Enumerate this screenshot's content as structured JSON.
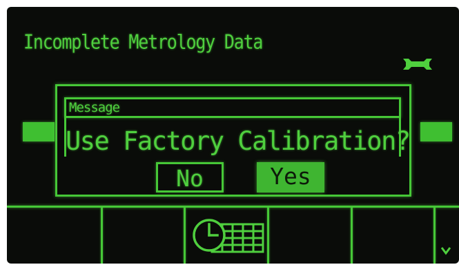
{
  "screen": {
    "title": "Incomplete Metrology Data",
    "status_icon": "wrench-icon"
  },
  "dialog": {
    "header": "Message",
    "question": "Use Factory Calibration?",
    "buttons": {
      "no_label": "No",
      "yes_label": "Yes",
      "selected": "Yes"
    }
  },
  "softkeys": [
    {
      "id": "softkey-1",
      "icon": ""
    },
    {
      "id": "softkey-2",
      "icon": ""
    },
    {
      "id": "softkey-3",
      "icon": "clock-calendar-icon"
    },
    {
      "id": "softkey-4",
      "icon": ""
    },
    {
      "id": "softkey-5",
      "icon": ""
    },
    {
      "id": "softkey-more",
      "icon": "chevron-down-icon"
    }
  ],
  "colors": {
    "display_background": "#0a0c09",
    "display_green": "#4fcf3e",
    "selected_fill": "#3fb531"
  }
}
